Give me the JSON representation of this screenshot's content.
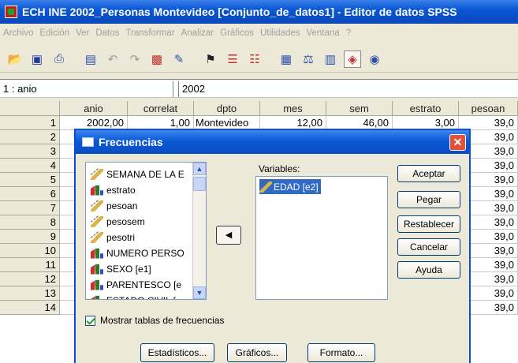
{
  "window": {
    "title": "ECH INE 2002_Personas Montevideo [Conjunto_de_datos1] - Editor de datos SPSS"
  },
  "menu": [
    "Archivo",
    "Edición",
    "Ver",
    "Datos",
    "Transformar",
    "Analizar",
    "Gráficos",
    "Utilidades",
    "Ventana",
    "?"
  ],
  "toolbar": {
    "icons": [
      "open-icon",
      "save-icon",
      "print-icon",
      "dialog-recall-icon",
      "undo-icon",
      "redo-icon",
      "goto-chart-icon",
      "goto-case-icon",
      "find-icon",
      "insert-case-icon",
      "insert-variable-icon",
      "split-file-icon",
      "weight-cases-icon",
      "select-cases-icon",
      "value-labels-icon",
      "use-sets-icon"
    ]
  },
  "cell_editor": {
    "ref": "1 : anio",
    "value": "2002"
  },
  "grid": {
    "columns": [
      "anio",
      "correlat",
      "dpto",
      "mes",
      "sem",
      "estrato",
      "pesoan"
    ],
    "rows": [
      "1",
      "2",
      "3",
      "4",
      "5",
      "6",
      "7",
      "8",
      "9",
      "10",
      "11",
      "12",
      "13",
      "14"
    ],
    "first_row": [
      "2002,00",
      "1,00",
      "Montevideo",
      "12,00",
      "46,00",
      "3,00",
      "39,0"
    ],
    "pesoan_values": [
      "39,0",
      "39,0",
      "39,0",
      "39,0",
      "39,0",
      "39,0",
      "39,0",
      "39,0",
      "39,0",
      "39,0",
      "39,0",
      "39,0",
      "39,0",
      "39,0"
    ]
  },
  "dialog": {
    "title": "Frecuencias",
    "source_list": [
      {
        "label": "SEMANA DE LA E",
        "icon": "scale-ruler-icon"
      },
      {
        "label": "estrato",
        "icon": "nominal-bars-icon"
      },
      {
        "label": "pesoan",
        "icon": "scale-ruler-icon"
      },
      {
        "label": "pesosem",
        "icon": "scale-ruler-icon"
      },
      {
        "label": "pesotri",
        "icon": "scale-ruler-icon"
      },
      {
        "label": "NUMERO PERSO",
        "icon": "nominal-bars-icon"
      },
      {
        "label": "SEXO [e1]",
        "icon": "nominal-bars-icon"
      },
      {
        "label": "PARENTESCO [e",
        "icon": "nominal-bars-icon"
      },
      {
        "label": "ESTADO CIVIL [",
        "icon": "nominal-bars-icon"
      }
    ],
    "variables_label": "Variables:",
    "variables": [
      {
        "label": "EDAD [e2]",
        "icon": "scale-ruler-icon"
      }
    ],
    "buttons": [
      "Aceptar",
      "Pegar",
      "Restablecer",
      "Cancelar",
      "Ayuda"
    ],
    "checkbox_label": "Mostrar tablas de frecuencias",
    "checkbox_checked": true,
    "bottom_buttons": [
      "Estadísticos...",
      "Gráficos...",
      "Formato..."
    ]
  }
}
